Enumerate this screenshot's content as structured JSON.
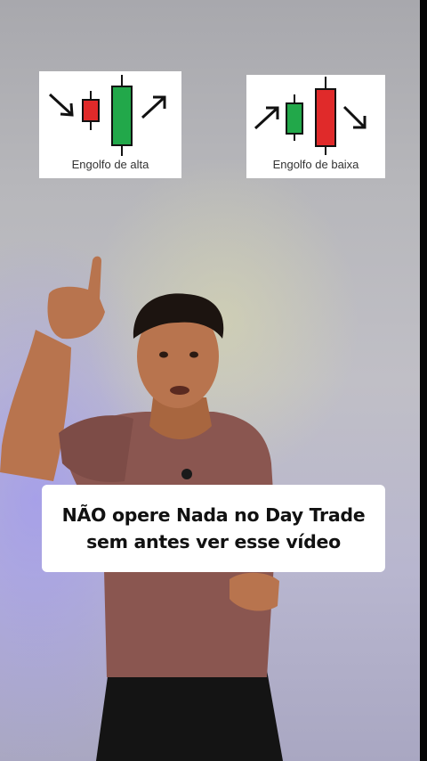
{
  "cards": {
    "alta": {
      "label": "Engolfo de alta",
      "small_candle_color": "#e02a2a",
      "big_candle_color": "#22a84a"
    },
    "baixa": {
      "label": "Engolfo de baixa",
      "small_candle_color": "#22a84a",
      "big_candle_color": "#e02a2a"
    }
  },
  "caption": {
    "line1": "NÃO opere Nada no Day Trade",
    "line2": "sem antes ver esse vídeo"
  },
  "colors": {
    "shirt": "#8a5650",
    "skin": "#b8744e",
    "hair": "#1c1410",
    "pants": "#141414"
  }
}
